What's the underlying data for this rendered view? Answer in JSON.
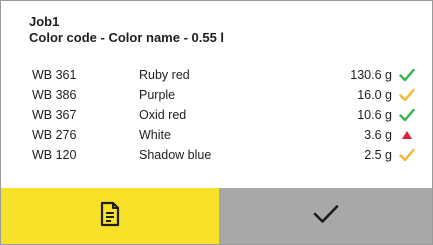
{
  "header": {
    "title": "Job1",
    "subtitle": "Color code - Color name - 0.55 l"
  },
  "rows": [
    {
      "code": "WB 361",
      "name": "Ruby red",
      "amount": "130.6 g",
      "status_icon": "check-icon",
      "status_color": "#2db84b"
    },
    {
      "code": "WB 386",
      "name": "Purple",
      "amount": "16.0 g",
      "status_icon": "check-icon",
      "status_color": "#f5b731"
    },
    {
      "code": "WB 367",
      "name": "Oxid red",
      "amount": "10.6 g",
      "status_icon": "check-icon",
      "status_color": "#2db84b"
    },
    {
      "code": "WB 276",
      "name": "White",
      "amount": "3.6 g",
      "status_icon": "warning-triangle-icon",
      "status_color": "#e0202a"
    },
    {
      "code": "WB 120",
      "name": "Shadow blue",
      "amount": "2.5 g",
      "status_icon": "check-icon",
      "status_color": "#f5b731"
    }
  ],
  "footer": {
    "report_button_icon": "document-icon",
    "confirm_button_icon": "checkmark-icon",
    "report_bg": "#f7e229",
    "confirm_bg": "#a8a8a8"
  },
  "colors": {
    "text": "#1f1f1f",
    "border": "#9a9a9a"
  }
}
